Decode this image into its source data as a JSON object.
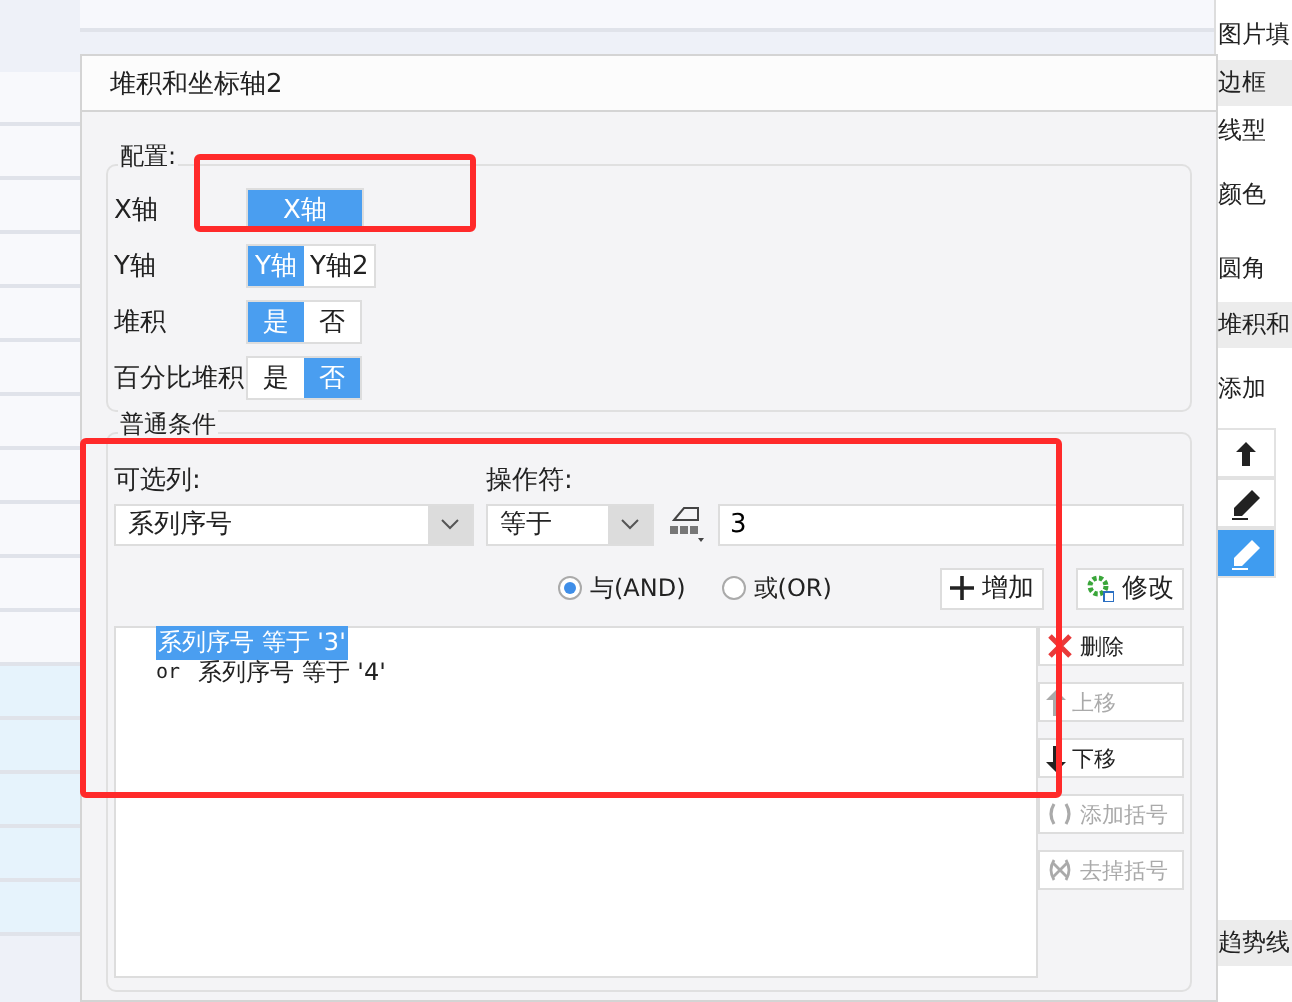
{
  "side_panel": {
    "items": [
      {
        "kind": "label",
        "text": "图片填"
      },
      {
        "kind": "header",
        "text": "边框"
      },
      {
        "kind": "label",
        "text": "线型"
      },
      {
        "kind": "label",
        "text": "颜色"
      },
      {
        "kind": "label",
        "text": "圆角"
      },
      {
        "kind": "header",
        "text": "堆积和"
      },
      {
        "kind": "label",
        "text": "添加"
      },
      {
        "kind": "up-tool",
        "selected": false
      },
      {
        "kind": "pencil-tool",
        "selected": false
      },
      {
        "kind": "pencil-tool",
        "selected": true
      },
      {
        "kind": "header",
        "text": "趋势线"
      }
    ]
  },
  "dialog": {
    "title": "堆积和坐标轴2",
    "config": {
      "legend": "配置:",
      "rows": [
        {
          "label": "X轴",
          "options": [
            {
              "label": "X轴",
              "selected": true
            }
          ]
        },
        {
          "label": "Y轴",
          "options": [
            {
              "label": "Y轴",
              "selected": true
            },
            {
              "label": "Y轴2",
              "selected": false
            }
          ]
        },
        {
          "label": "堆积",
          "options": [
            {
              "label": "是",
              "selected": true
            },
            {
              "label": "否",
              "selected": false
            }
          ]
        },
        {
          "label": "百分比堆积",
          "options": [
            {
              "label": "是",
              "selected": false
            },
            {
              "label": "否",
              "selected": true
            }
          ]
        }
      ]
    },
    "condition": {
      "legend": "普通条件",
      "column_label": "可选列:",
      "operator_label": "操作符:",
      "column_select": "系列序号",
      "operator_select": "等于",
      "value": "3",
      "joins": [
        {
          "label": "与(AND)",
          "selected": true
        },
        {
          "label": "或(OR)",
          "selected": false
        }
      ],
      "add_button": "增加",
      "modify_button": "修改",
      "conditions": [
        {
          "text": "系列序号 等于 '3'",
          "selected": true
        },
        {
          "prefix": "or",
          "text": "系列序号 等于 '4'",
          "selected": false
        }
      ],
      "side_buttons": [
        {
          "kind": "delete",
          "label": "删除",
          "disabled": false
        },
        {
          "kind": "up",
          "label": "上移",
          "disabled": true
        },
        {
          "kind": "down",
          "label": "下移",
          "disabled": false
        },
        {
          "kind": "add-bracket",
          "label": "添加括号",
          "disabled": true
        },
        {
          "kind": "remove-bracket",
          "label": "去掉括号",
          "disabled": true
        }
      ]
    }
  }
}
